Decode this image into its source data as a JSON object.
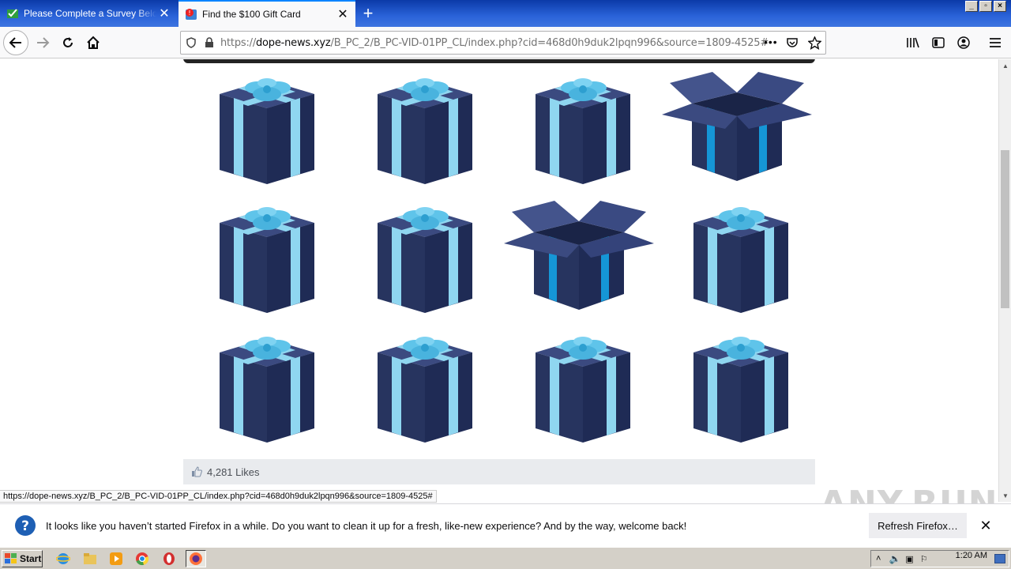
{
  "tabs": [
    {
      "title": "Please Complete a Survey Below to Claim",
      "favicon": "survey-favicon"
    },
    {
      "title": "Find the $100 Gift Card",
      "favicon": "alert-favicon"
    }
  ],
  "window_buttons": {
    "minimize": "_",
    "restore": "▫",
    "close": "×"
  },
  "url": {
    "prefix": "https://",
    "domain": "dope-news.xyz",
    "path": "/B_PC_2/B_PC-VID-01PP_CL/index.php?cid=468d0h9duk2lpqn996&source=1809-4525#"
  },
  "gifts": [
    {
      "state": "closed"
    },
    {
      "state": "closed"
    },
    {
      "state": "closed"
    },
    {
      "state": "open"
    },
    {
      "state": "closed"
    },
    {
      "state": "closed"
    },
    {
      "state": "open"
    },
    {
      "state": "closed"
    },
    {
      "state": "closed"
    },
    {
      "state": "closed"
    },
    {
      "state": "closed"
    },
    {
      "state": "closed"
    }
  ],
  "likes": {
    "text": "4,281 Likes"
  },
  "status_url": "https://dope-news.xyz/B_PC_2/B_PC-VID-01PP_CL/index.php?cid=468d0h9duk2lpqn996&source=1809-4525#",
  "notification": {
    "message": "It looks like you haven’t started Firefox in a while. Do you want to clean it up for a fresh, like-new experience? And by the way, welcome back!",
    "button": "Refresh Firefox…"
  },
  "watermark": "ANY.RUN",
  "taskbar": {
    "start": "Start",
    "clock": "1:20 AM"
  },
  "colors": {
    "box": "#1f2b55",
    "ribbon": "#8fd6f0",
    "accent": "#0a84ff"
  }
}
